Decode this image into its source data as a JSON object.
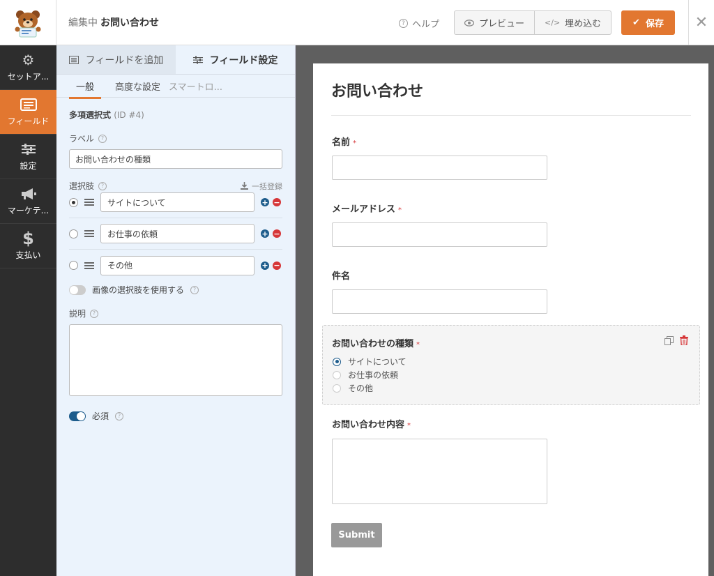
{
  "header": {
    "editing_prefix": "編集中",
    "form_name": "お問い合わせ",
    "help_label": "ヘルプ",
    "preview_label": "プレビュー",
    "embed_label": "埋め込む",
    "save_label": "保存"
  },
  "sidebar": {
    "items": [
      {
        "label": "セットア...",
        "icon": "gear-icon"
      },
      {
        "label": "フィールド",
        "icon": "fields-icon"
      },
      {
        "label": "設定",
        "icon": "sliders-icon"
      },
      {
        "label": "マーケテ...",
        "icon": "megaphone-icon"
      },
      {
        "label": "支払い",
        "icon": "dollar-icon"
      }
    ]
  },
  "panel": {
    "tabs": [
      "フィールドを追加",
      "フィールド設定"
    ],
    "subtabs": [
      "一般",
      "高度な設定",
      "スマートロ..."
    ],
    "field_type": "多項選択式",
    "field_id": "(ID #4)",
    "label_label": "ラベル",
    "label_value": "お問い合わせの種類",
    "choices_label": "選択肢",
    "bulk_add_label": "一括登録",
    "choices": [
      {
        "text": "サイトについて",
        "selected": true
      },
      {
        "text": "お仕事の依頼",
        "selected": false
      },
      {
        "text": "その他",
        "selected": false
      }
    ],
    "image_choices_label": "画像の選択肢を使用する",
    "description_label": "説明",
    "required_label": "必須"
  },
  "preview": {
    "title": "お問い合わせ",
    "fields": {
      "name": "名前",
      "email": "メールアドレス",
      "subject": "件名",
      "type": "お問い合わせの種類",
      "content": "お問い合わせ内容"
    },
    "required_mark": "*",
    "radio_options": [
      "サイトについて",
      "お仕事の依頼",
      "その他"
    ],
    "submit_label": "Submit"
  },
  "colors": {
    "accent": "#e27730",
    "sidebar_bg": "#2d2d2d",
    "panel_bg": "#ebf3fc",
    "link_blue": "#1d5c8c",
    "required_red": "#d63638"
  }
}
